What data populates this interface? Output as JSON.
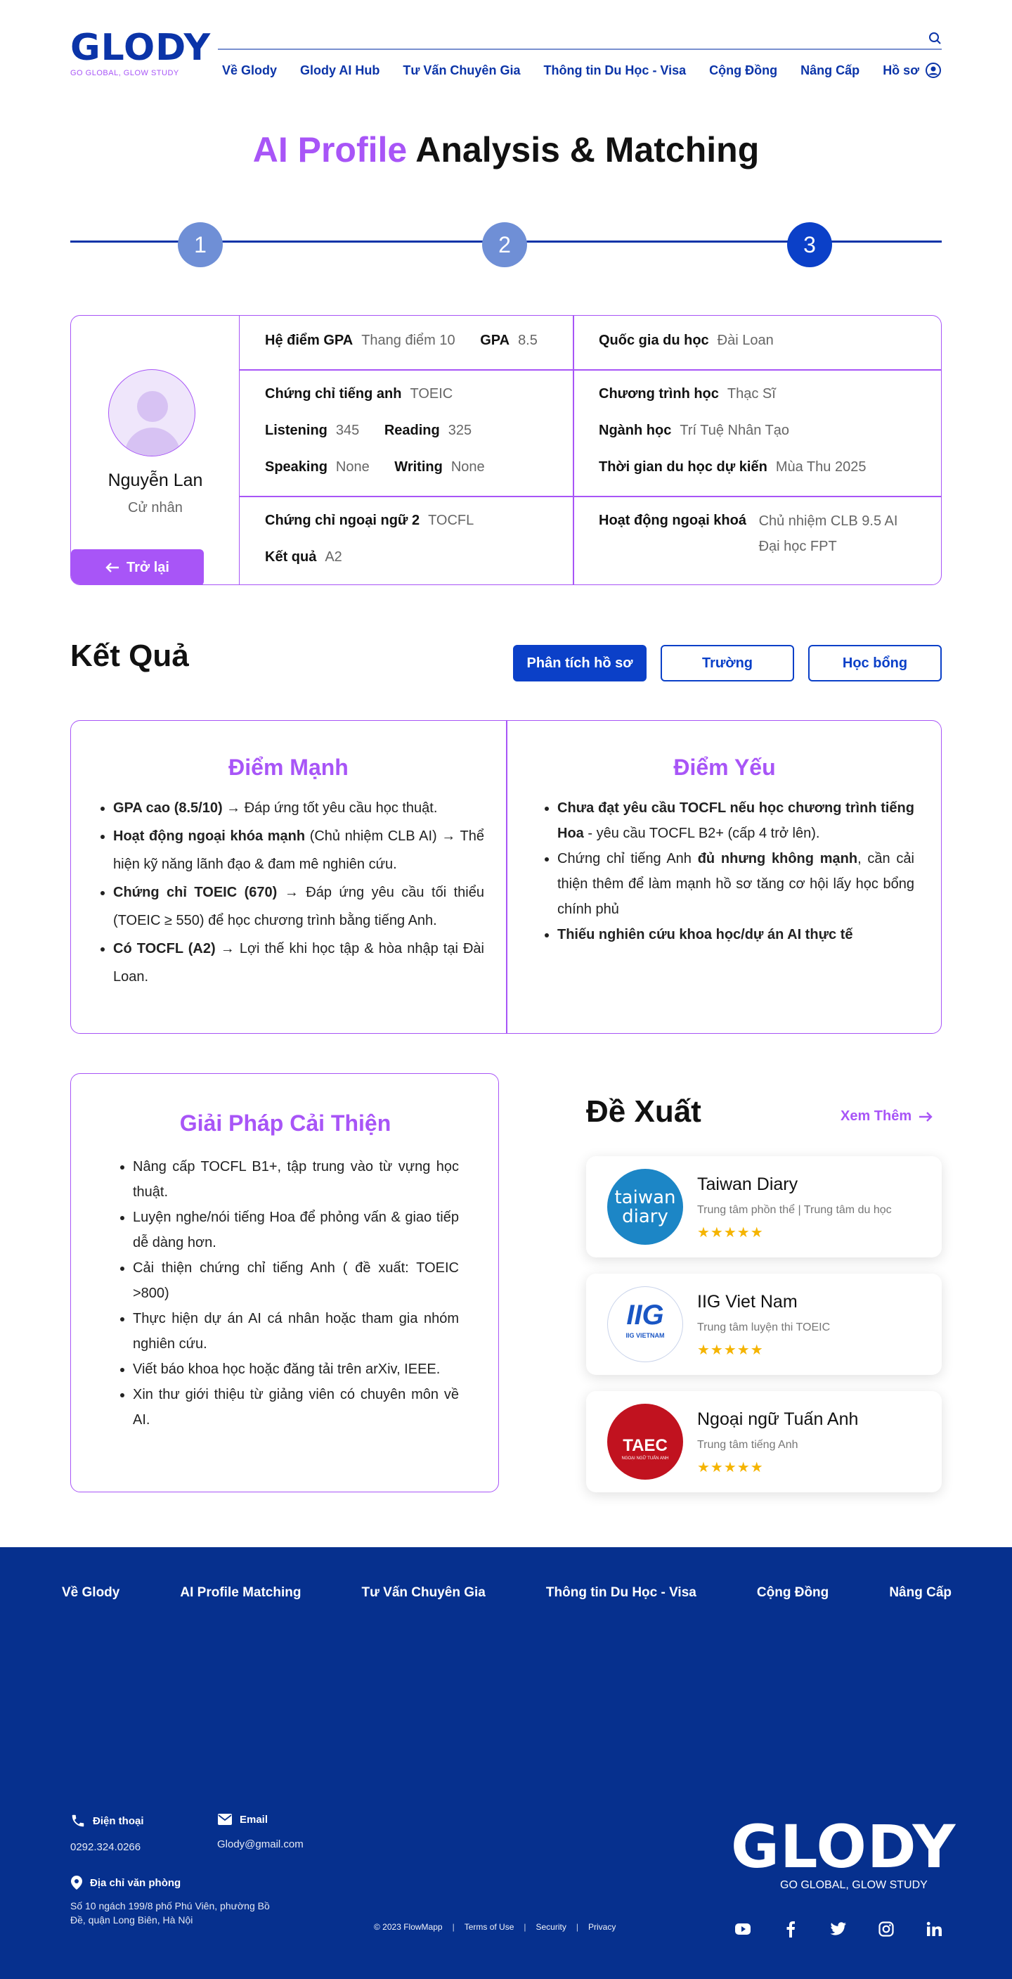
{
  "brand": {
    "name": "GLODY",
    "tagline": "GO GLOBAL, GLOW STUDY",
    "color": "#0b34a8",
    "accent": "#a855f7"
  },
  "nav": {
    "items": [
      "Về Glody",
      "Glody AI Hub",
      "Tư Vấn Chuyên Gia",
      "Thông tin Du Học - Visa",
      "Cộng Đồng",
      "Nâng Cấp",
      "Hồ sơ"
    ]
  },
  "page": {
    "title_accent": "AI Profile",
    "title_rest": " Analysis & Matching"
  },
  "steps": [
    "1",
    "2",
    "3"
  ],
  "profile": {
    "name": "Nguyễn Lan",
    "degree": "Cử nhân",
    "back_label": "Trở lại",
    "gpa_system_label": "Hệ điểm GPA",
    "gpa_system_value": "Thang điểm 10",
    "gpa_label": "GPA",
    "gpa_value": "8.5",
    "country_label": "Quốc gia du học",
    "country_value": "Đài Loan",
    "english_cert_label": "Chứng chỉ tiếng anh",
    "english_cert_value": "TOEIC",
    "listening_label": "Listening",
    "listening_value": "345",
    "reading_label": "Reading",
    "reading_value": "325",
    "speaking_label": "Speaking",
    "speaking_value": "None",
    "writing_label": "Writing",
    "writing_value": "None",
    "program_label": "Chương trình học",
    "program_value": "Thạc Sĩ",
    "major_label": "Ngành học",
    "major_value": "Trí Tuệ Nhân Tạo",
    "time_label": "Thời gian du học dự kiến",
    "time_value": "Mùa Thu 2025",
    "lang2_label": "Chứng chỉ ngoại ngữ 2",
    "lang2_value": "TOCFL",
    "result_label": "Kết quả",
    "result_value": "A2",
    "extra_label": "Hoạt động ngoại khoá",
    "extra_value_1": "Chủ nhiệm CLB 9.5 AI",
    "extra_value_2": "Đại học FPT"
  },
  "results": {
    "heading": "Kết Quả",
    "tabs": [
      "Phân tích hồ sơ",
      "Trường",
      "Học bổng"
    ],
    "strengths": {
      "title": "Điểm Mạnh",
      "items": [
        {
          "bold": "GPA cao (8.5/10)",
          "text": " → Đáp ứng tốt yêu cầu học thuật."
        },
        {
          "bold": "Hoạt động ngoại khóa mạnh",
          "text": " (Chủ nhiệm CLB AI) → Thể hiện kỹ năng lãnh đạo & đam mê nghiên cứu."
        },
        {
          "bold": "Chứng chỉ TOEIC (670)",
          "text": " → Đáp ứng yêu cầu tối thiểu (TOEIC ≥ 550) để học chương trình bằng tiếng Anh."
        },
        {
          "bold": "Có TOCFL (A2)",
          "text": " → Lợi thế khi học tập & hòa nhập tại Đài Loan."
        }
      ]
    },
    "weaknesses": {
      "title": "Điểm Yếu",
      "item1_bold": "Chưa đạt yêu cầu TOCFL nếu học chương trình tiếng Hoa",
      "item1_text": " - yêu cầu TOCFL B2+ (cấp 4 trở lên).",
      "item2_text_a": "Chứng chỉ tiếng Anh ",
      "item2_bold": "đủ nhưng không mạnh",
      "item2_text_b": ", cần cải thiện thêm để làm mạnh hồ sơ tăng cơ hội lấy học bổng chính phủ",
      "item3_bold": "Thiếu nghiên cứu khoa học/dự án AI thực tế"
    }
  },
  "solutions": {
    "title": "Giải Pháp Cải Thiện",
    "items": [
      "Nâng cấp TOCFL B1+, tập trung vào từ vựng học thuật.",
      "Luyện nghe/nói tiếng Hoa để phỏng vấn & giao tiếp dễ dàng hơn.",
      "Cải thiện chứng chỉ tiếng Anh ( đề xuất: TOEIC >800)",
      "Thực hiện dự án AI cá nhân hoặc tham gia nhóm nghiên cứu.",
      "Viết báo khoa học hoặc đăng tải trên arXiv, IEEE.",
      "Xin thư giới thiệu từ giảng viên có chuyên môn về AI."
    ]
  },
  "recommend": {
    "heading": "Đề Xuất",
    "more_label": "Xem Thêm",
    "items": [
      {
        "name": "Taiwan Diary",
        "sub": "Trung tâm phồn thể  |  Trung tâm du học",
        "logo_text_1": "taiwan",
        "logo_text_2": "diary",
        "rating": 4.5,
        "stars": "★★★★★"
      },
      {
        "name": "IIG Viet Nam",
        "sub": "Trung tâm luyện thi TOEIC",
        "logo_text_1": "IIG",
        "logo_text_2": "IIG VIETNAM",
        "rating": 4.5,
        "stars": "★★★★★"
      },
      {
        "name": "Ngoại ngữ Tuấn Anh",
        "sub": "Trung tâm tiếng Anh",
        "logo_text_1": "TAEC",
        "logo_text_2": "NGOẠI NGỮ TUẤN ANH",
        "rating": 4.5,
        "stars": "★★★★★"
      }
    ]
  },
  "footer": {
    "nav": [
      "Về Glody",
      "AI Profile Matching",
      "Tư Vấn Chuyên Gia",
      "Thông tin Du Học - Visa",
      "Cộng Đồng",
      "Nâng Cấp"
    ],
    "phone_label": "Điện thoại",
    "phone_value": "0292.324.0266",
    "email_label": "Email",
    "email_value": "Glody@gmail.com",
    "address_label": "Địa chỉ văn phòng",
    "address_line_1": "Số 10 ngách 199/8 phố Phú Viên, phường Bồ",
    "address_line_2": "Đề, quận Long Biên, Hà Nội",
    "copyright": "© 2023 FlowMapp",
    "links": [
      "Terms of Use",
      "Security",
      "Privacy"
    ],
    "bg_color": "#06308e",
    "social": [
      "youtube-icon",
      "facebook-icon",
      "twitter-icon",
      "instagram-icon",
      "linkedin-icon"
    ]
  }
}
